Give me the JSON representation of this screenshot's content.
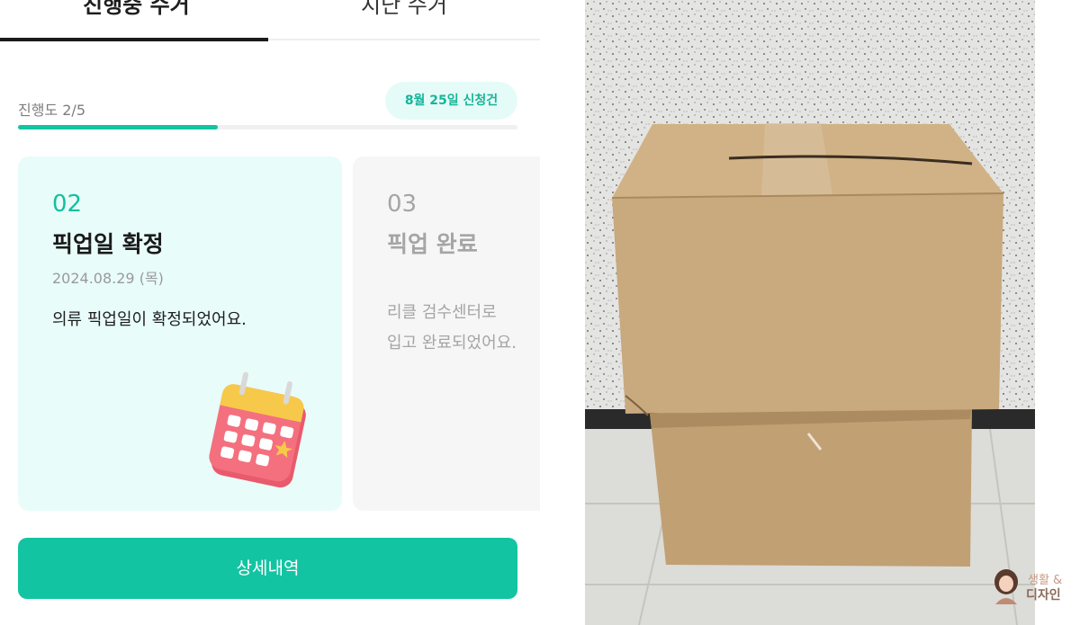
{
  "tabs": [
    {
      "label": "진행중 수거"
    },
    {
      "label": "지난 수거"
    }
  ],
  "progress": {
    "label": "진행도 2/5",
    "current_step": 2,
    "total_steps": 5
  },
  "request_badge": "8월 25일 신청건",
  "cards": [
    {
      "number": "02",
      "title": "픽업일 확정",
      "date": "2024.08.29 (목)",
      "description": "의류 픽업일이 확정되었어요."
    },
    {
      "number": "03",
      "title": "픽업 완료",
      "description_line1": "리클 검수센터로",
      "description_line2": "입고 완료되었어요."
    }
  ],
  "detail_button": "상세내역",
  "watermark": {
    "line1": "생활 &",
    "line2": "디자인"
  },
  "colors": {
    "accent": "#13c4a3",
    "card_active_bg": "#e8fcf9",
    "card_inactive_bg": "#f6f6f6",
    "badge_bg": "#e5fbf7",
    "cardboard": "#c8a77c"
  },
  "icons": {
    "calendar": "calendar-star-icon"
  }
}
